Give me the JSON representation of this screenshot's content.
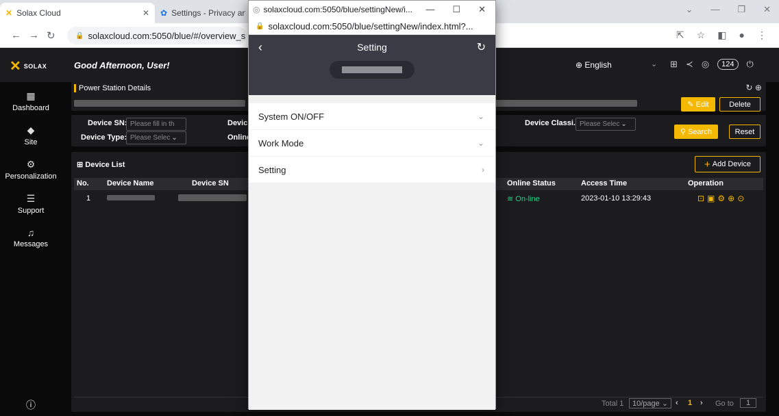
{
  "browser": {
    "tabs": [
      {
        "title": "Solax Cloud",
        "icon": "solax-x-icon"
      },
      {
        "title": "Settings - Privacy and",
        "icon": "gear-icon"
      }
    ],
    "address": "solaxcloud.com:5050/blue/#/overview_s"
  },
  "popup": {
    "window_title": "solaxcloud.com:5050/blue/settingNew/i...",
    "url": "solaxcloud.com:5050/blue/settingNew/index.html?...",
    "header_title": "Setting",
    "menu": [
      {
        "label": "System ON/OFF",
        "chevron": "chevron-down-icon"
      },
      {
        "label": "Work Mode",
        "chevron": "chevron-down-icon"
      },
      {
        "label": "Setting",
        "chevron": "chevron-right-icon"
      }
    ]
  },
  "app": {
    "logo_text": "SOLAX",
    "greeting": "Good Afternoon, User!",
    "language": "English",
    "notification_count": "124",
    "sidebar": [
      {
        "label": "Dashboard",
        "icon": "dashboard-icon"
      },
      {
        "label": "Site",
        "icon": "site-icon"
      },
      {
        "label": "Personalization",
        "icon": "personalization-icon"
      },
      {
        "label": "Support",
        "icon": "support-icon"
      },
      {
        "label": "Messages",
        "icon": "bell-icon"
      }
    ],
    "power_station_title": "Power Station Details",
    "edit_label": "Edit",
    "delete_label": "Delete",
    "filters": {
      "device_sn_label": "Device SN:",
      "device_sn_placeholder": "Please fill in th",
      "device_type_label": "Device Type:",
      "device_type_placeholder": "Please Selec",
      "device_partial_label": "Devic",
      "online_partial_label": "Online",
      "device_class_label": "Device Classi...",
      "device_class_placeholder": "Please Selec",
      "search_label": "Search",
      "reset_label": "Reset"
    },
    "device_list_title": "Device List",
    "add_device_label": "Add Device",
    "table": {
      "headers": [
        "No.",
        "Device Name",
        "Device SN",
        "Online Status",
        "Access Time",
        "Operation"
      ],
      "rows": [
        {
          "no": "1",
          "status": "On-line",
          "access_time": "2023-01-10 13:29:43"
        }
      ]
    },
    "pagination": {
      "total": "Total 1",
      "page_size": "10/page",
      "current_page": "1",
      "goto_label": "Go to",
      "goto_value": "1"
    },
    "colors": {
      "accent": "#f5b800",
      "online": "#1fd18a",
      "dark_bg": "#1c1c1e"
    }
  }
}
